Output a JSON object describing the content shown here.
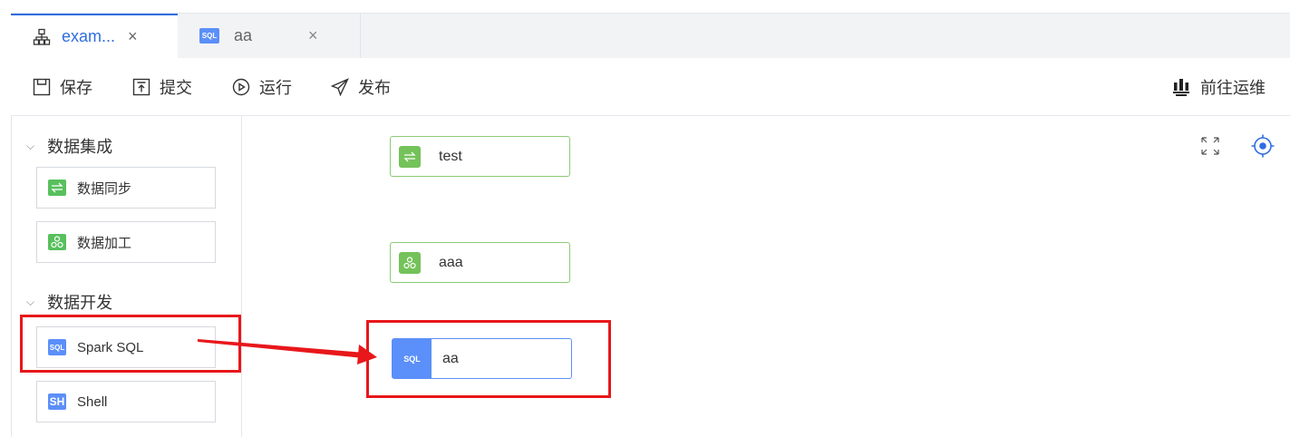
{
  "tabs": [
    {
      "label": "exam...",
      "icon": "flow-graph-icon",
      "close": "×",
      "active": true
    },
    {
      "label": "aa",
      "icon": "sql-icon",
      "badge": "SQL",
      "close": "×",
      "active": false
    }
  ],
  "toolbar": {
    "save": "保存",
    "submit": "提交",
    "run": "运行",
    "publish": "发布",
    "goto_ops": "前往运维"
  },
  "sidebar": {
    "groups": [
      {
        "title": "数据集成",
        "chevron": "⌵",
        "items": [
          {
            "label": "数据同步",
            "icon": "sync-icon"
          },
          {
            "label": "数据加工",
            "icon": "process-icon"
          }
        ]
      },
      {
        "title": "数据开发",
        "chevron": "⌵",
        "items": [
          {
            "label": "Spark SQL",
            "icon": "sql-icon",
            "badge": "SQL"
          },
          {
            "label": "Shell",
            "icon": "shell-icon",
            "badge": "SH"
          }
        ]
      }
    ]
  },
  "canvas": {
    "nodes": [
      {
        "label": "test",
        "icon": "sync-icon",
        "color": "#74c25a"
      },
      {
        "label": "aaa",
        "icon": "process-icon",
        "color": "#74c25a"
      },
      {
        "label": "aa",
        "icon": "sql-icon",
        "badge": "SQL",
        "color": "#5b8ff9"
      }
    ],
    "controls": [
      "fit-view-icon",
      "locate-icon"
    ]
  },
  "colors": {
    "accent": "#2f6de1",
    "green": "#74c25a",
    "blue": "#5b8ff9",
    "highlight": "#e8171b"
  }
}
